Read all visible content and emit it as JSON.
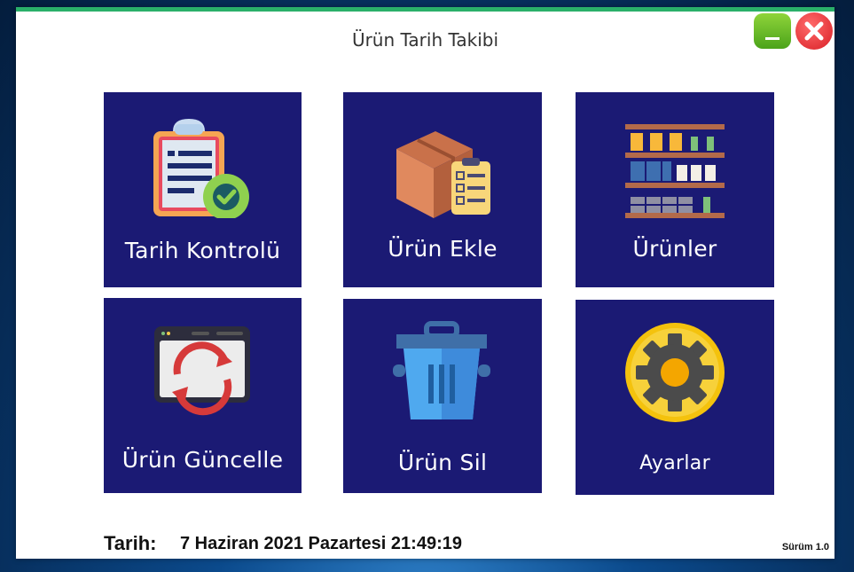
{
  "window": {
    "title": "Ürün Tarih Takibi",
    "accent_color": "#2ab06a"
  },
  "controls": {
    "minimize_icon": "minimize-icon",
    "close_icon": "close-icon"
  },
  "tiles": [
    {
      "label": "Tarih Kontrolü",
      "icon": "clipboard-check-icon"
    },
    {
      "label": "Ürün Ekle",
      "icon": "box-checklist-icon"
    },
    {
      "label": "Ürünler",
      "icon": "shelves-icon"
    },
    {
      "label": "Ürün Güncelle",
      "icon": "browser-refresh-icon"
    },
    {
      "label": "Ürün Sil",
      "icon": "trash-bin-icon"
    },
    {
      "label": "Ayarlar",
      "icon": "gear-icon"
    }
  ],
  "tile_color": "#1b1a74",
  "footer": {
    "date_label": "Tarih:",
    "date_value": "7 Haziran 2021 Pazartesi 21:49:19",
    "version": "Sürüm 1.0"
  }
}
